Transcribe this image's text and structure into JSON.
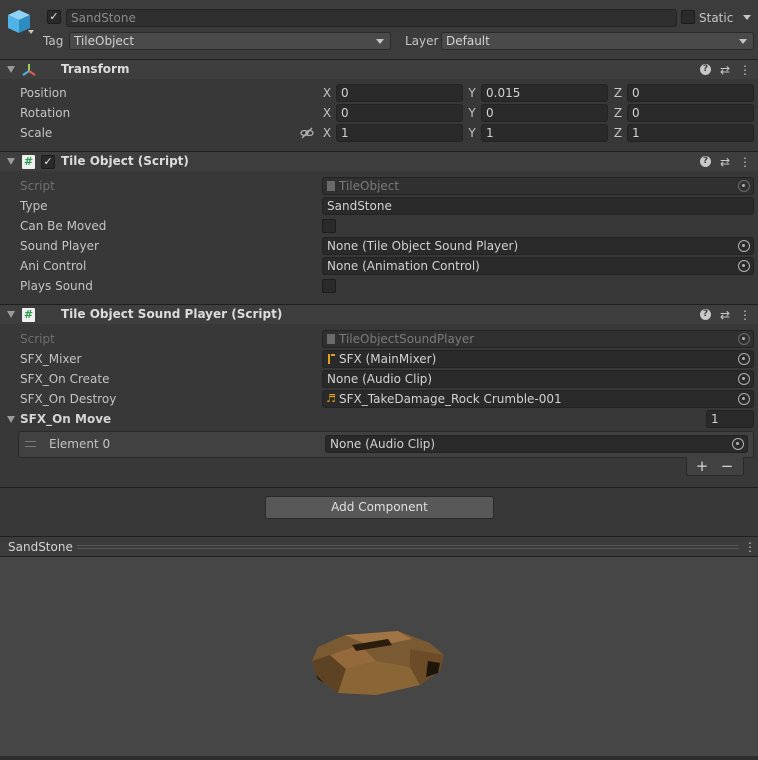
{
  "header": {
    "object_name": "SandStone",
    "static_label": "Static",
    "tag_label": "Tag",
    "tag_value": "TileObject",
    "layer_label": "Layer",
    "layer_value": "Default"
  },
  "transform": {
    "title": "Transform",
    "rows": [
      {
        "label": "Position",
        "x": "0",
        "y": "0.015",
        "z": "0"
      },
      {
        "label": "Rotation",
        "x": "0",
        "y": "0",
        "z": "0"
      },
      {
        "label": "Scale",
        "x": "1",
        "y": "1",
        "z": "1"
      }
    ],
    "axis_x": "X",
    "axis_y": "Y",
    "axis_z": "Z"
  },
  "tile_object": {
    "title": "Tile Object (Script)",
    "script_label": "Script",
    "script_value": "TileObject",
    "type_label": "Type",
    "type_value": "SandStone",
    "can_be_moved_label": "Can Be Moved",
    "sound_player_label": "Sound Player",
    "sound_player_value": "None (Tile Object Sound Player)",
    "ani_control_label": "Ani Control",
    "ani_control_value": "None (Animation Control)",
    "plays_sound_label": "Plays Sound"
  },
  "sound_player": {
    "title": "Tile Object Sound Player (Script)",
    "script_label": "Script",
    "script_value": "TileObjectSoundPlayer",
    "mixer_label": "SFX_Mixer",
    "mixer_value": "SFX (MainMixer)",
    "on_create_label": "SFX_On Create",
    "on_create_value": "None (Audio Clip)",
    "on_destroy_label": "SFX_On Destroy",
    "on_destroy_value": "SFX_TakeDamage_Rock Crumble-001",
    "on_move_label": "SFX_On Move",
    "on_move_count": "1",
    "element0_label": "Element 0",
    "element0_value": "None (Audio Clip)",
    "plus": "+",
    "minus": "−"
  },
  "add_component_label": "Add Component",
  "preview": {
    "title": "SandStone"
  },
  "colors": {
    "accent_icon": "#4fb3e8",
    "rock": "#7a5a33"
  }
}
